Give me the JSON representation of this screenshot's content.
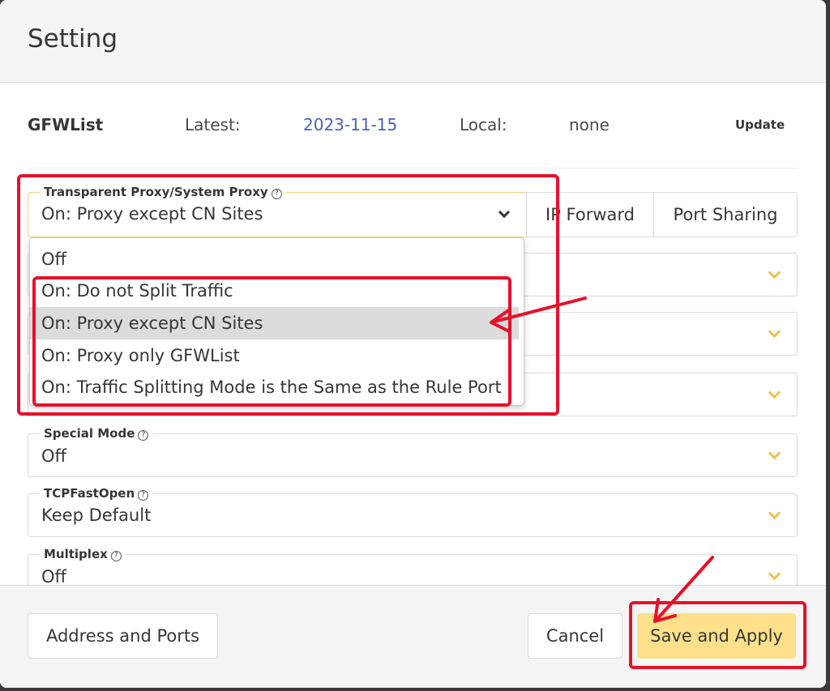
{
  "dialog": {
    "title": "Setting"
  },
  "gfwlist": {
    "name": "GFWList",
    "latest_label": "Latest:",
    "latest_value": "2023-11-15",
    "local_label": "Local:",
    "local_value": "none",
    "update_label": "Update"
  },
  "transparent_proxy": {
    "legend": "Transparent Proxy/System Proxy",
    "value": "On: Proxy except CN Sites",
    "ip_forward_label": "IP Forward",
    "port_sharing_label": "Port Sharing",
    "options": [
      "Off",
      "On: Do not Split Traffic",
      "On: Proxy except CN Sites",
      "On: Proxy only GFWList",
      "On: Traffic Splitting Mode is the Same as the Rule Port"
    ],
    "selected_option": "On: Proxy except CN Sites"
  },
  "fields": {
    "special_mode": {
      "legend": "Special Mode",
      "value": "Off"
    },
    "tcp_fast_open": {
      "legend": "TCPFastOpen",
      "value": "Keep Default"
    },
    "multiplex": {
      "legend": "Multiplex",
      "value": "Off"
    }
  },
  "footer": {
    "address_ports_label": "Address and Ports",
    "cancel_label": "Cancel",
    "save_label": "Save and Apply"
  },
  "colors": {
    "accent_yellow": "#ffe08a",
    "link_blue": "#485fc7",
    "annotation_red": "#e8102a",
    "chevron_yellow": "#f0c050"
  },
  "icons": {
    "help": "question-circle-icon",
    "dropdown": "chevron-down-icon",
    "annotation": "arrow-annotation"
  }
}
